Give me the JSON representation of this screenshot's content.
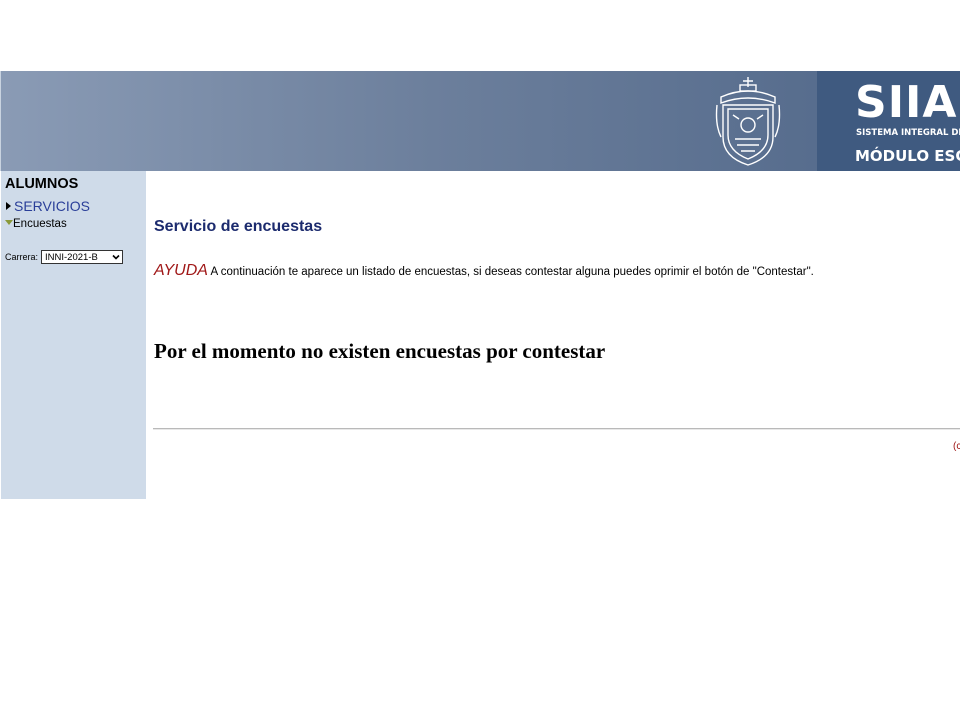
{
  "header": {
    "brand_title": "SIIAU",
    "brand_subtitle": "SISTEMA INTEGRAL DE INFORMACIÓN Y ADMINISTRACIÓN UNIVERSITARIA",
    "brand_module": "MÓDULO ESCOLAR",
    "crest_icon": "university-crest-icon"
  },
  "sidebar": {
    "heading": "ALUMNOS",
    "services_label": "SERVICIOS",
    "current_item": "Encuestas",
    "carrera_label": "Carrera:",
    "carrera_value": "INNI-2021-B"
  },
  "main": {
    "title": "Servicio de encuestas",
    "help_label": "AYUDA",
    "help_text": " A continuación te aparece un listado de encuestas, si deseas contestar alguna puedes oprimir el botón de \"Contestar\".",
    "empty_message": "Por el momento no existen encuestas por contestar",
    "footer_fragment": "(c"
  },
  "colors": {
    "header_start": "#8a9bb5",
    "header_end": "#4f6688",
    "brand_panel": "#3f5a80",
    "sidebar_bg": "#cfdbe9",
    "title_color": "#1c2b6e",
    "help_red": "#a01818"
  }
}
